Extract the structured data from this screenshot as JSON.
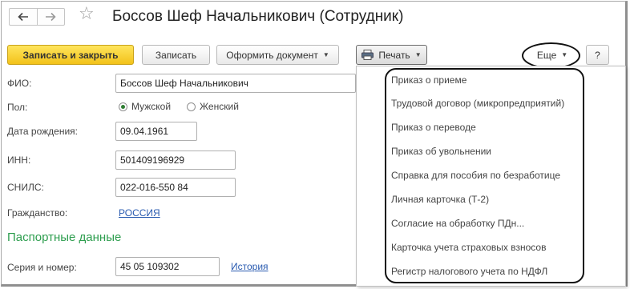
{
  "window": {
    "title": "Боссов Шеф Начальникович (Сотрудник)"
  },
  "toolbar": {
    "save_close": "Записать и закрыть",
    "save": "Записать",
    "document": "Оформить документ",
    "print": "Печать",
    "more": "Еще",
    "help": "?"
  },
  "form": {
    "fio_label": "ФИО:",
    "fio_value": "Боссов Шеф Начальникович",
    "gender_label": "Пол:",
    "gender_male": "Мужской",
    "gender_female": "Женский",
    "gender_selected": "Мужской",
    "birth_label": "Дата рождения:",
    "birth_value": "09.04.1961",
    "inn_label": "ИНН:",
    "inn_value": "501409196929",
    "snils_label": "СНИЛС:",
    "snils_value": "022-016-550 84",
    "citizenship_label": "Гражданство:",
    "citizenship_value": "РОССИЯ",
    "passport_section": "Паспортные данные",
    "series_label": "Серия и номер:",
    "series_value": "45 05 109302",
    "history_link": "История"
  },
  "print_menu": {
    "items": [
      "Приказ о приеме",
      "Трудовой договор (микропредприятий)",
      "Приказ о переводе",
      "Приказ об увольнении",
      "Справка для пособия по безработице",
      "Личная карточка (Т-2)",
      "Согласие на обработку ПДн...",
      "Карточка учета страховых взносов",
      "Регистр налогового учета по НДФЛ"
    ]
  },
  "icons": {
    "back": "arrow-left-icon",
    "forward": "arrow-right-icon",
    "favorite": "star-icon",
    "printer": "printer-icon"
  },
  "colors": {
    "primary_button": "#f2c21a",
    "section_heading": "#2e9e4f",
    "link": "#2a5bb0",
    "radio_selected": "#2e7d32"
  }
}
